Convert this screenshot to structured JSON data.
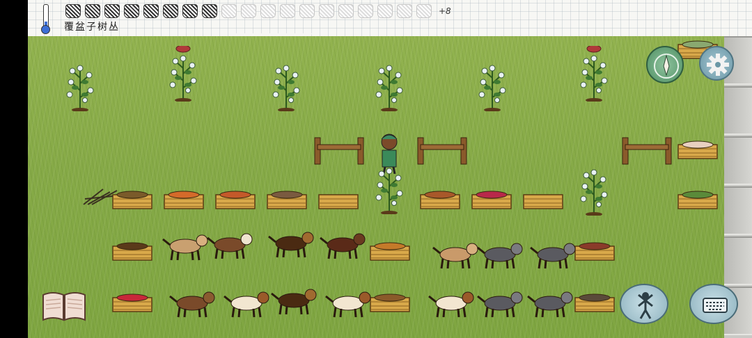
{
  "hud": {
    "hovered_object": "覆盆子树丛",
    "food_bonus": "+8",
    "food_pips": {
      "total": 19,
      "filled": 8
    },
    "temperature_icon": "thermometer-icon"
  },
  "controls": {
    "compass_icon": "compass-icon",
    "settings_icon": "gear-icon",
    "tech_book_icon": "book-icon",
    "emote_icon": "emote-icon",
    "keyboard_icon": "keyboard-icon"
  },
  "colors": {
    "grass": "#86aa47",
    "crate": "#d9a94a",
    "fence": "#8a5a2b",
    "accent_blue": "#3d6fd6"
  }
}
